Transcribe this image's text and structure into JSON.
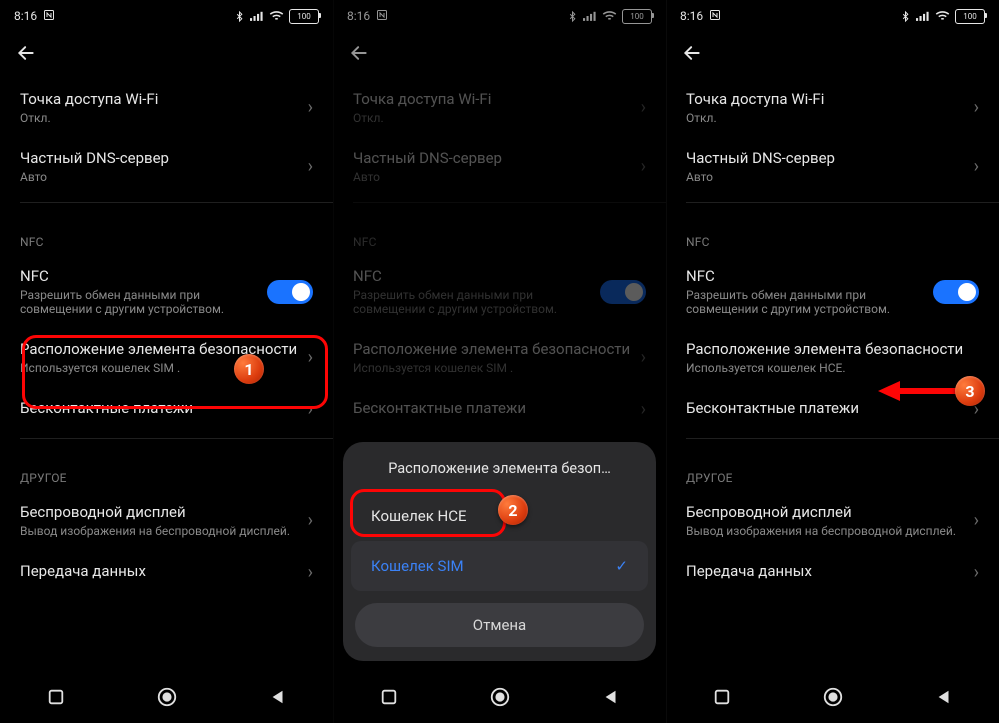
{
  "status": {
    "time": "8:16",
    "battery": "100"
  },
  "items": {
    "wifi_ap": {
      "title": "Точка доступа Wi-Fi",
      "sub": "Откл."
    },
    "dns": {
      "title": "Частный DNS-сервер",
      "sub": "Авто"
    },
    "nfc": {
      "title": "NFC",
      "sub": "Разрешить обмен данными при совмещении с другим устройством."
    },
    "secure": {
      "title": "Расположение элемента безопасности",
      "sub_sim": "Используется кошелек SIM .",
      "sub_hce": "Используется кошелек HCE."
    },
    "contactless": {
      "title": "Бесконтактные платежи"
    },
    "wireless_display": {
      "title": "Беспроводной дисплей",
      "sub": "Вывод изображения на беспроводной дисплей."
    },
    "data_transfer": {
      "title": "Передача данных"
    }
  },
  "sections": {
    "nfc": "NFC",
    "other": "ДРУГОЕ"
  },
  "dialog": {
    "title": "Расположение элемента безоп…",
    "opt_hce": "Кошелек HCE",
    "opt_sim": "Кошелек SIM",
    "cancel": "Отмена"
  },
  "badges": {
    "b1": "1",
    "b2": "2",
    "b3": "3"
  }
}
